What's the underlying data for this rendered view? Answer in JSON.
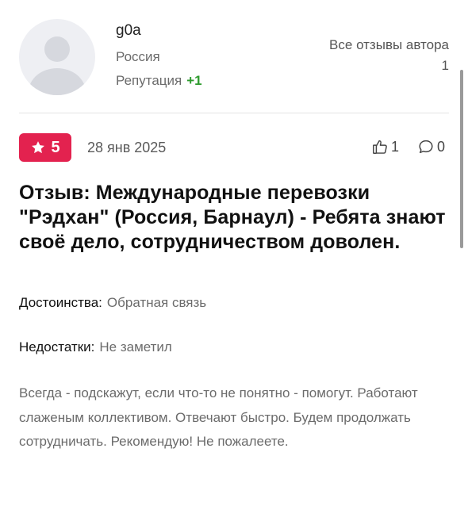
{
  "author": {
    "name": "g0a",
    "country": "Россия",
    "reputation_label": "Репутация",
    "reputation_value": "+1",
    "reputation_color": "#2e9b2e",
    "avatar_icon": "user-silhouette-icon"
  },
  "author_reviews": {
    "label": "Все отзывы автора",
    "count": "1"
  },
  "review": {
    "rating": "5",
    "rating_color": "#e3224f",
    "date": "28 янв 2025",
    "likes": "1",
    "comments": "0",
    "title": "Отзыв: Международные перевозки \"Рэдхан\" (Россия, Барнаул) - Ребята знают своё дело, сотрудничеством доволен.",
    "pros_label": "Достоинства:",
    "pros": "Обратная связь",
    "cons_label": "Недостатки:",
    "cons": "Не заметил",
    "body": "Всегда - подскажут, если что-то не понятно - помогут. Работают слаженым коллективом. Отвечают быстро. Будем продолжать сотрудничать. Рекомендую! Не пожалеете."
  }
}
